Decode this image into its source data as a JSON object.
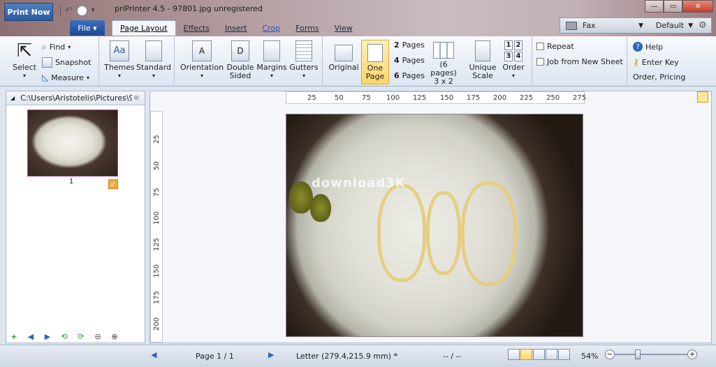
{
  "titlebar": {
    "print_now": "Print Now",
    "title": "priPrinter 4.5 - 97801.jpg unregistered",
    "min": "—",
    "max": "▭",
    "close": "✕"
  },
  "tabs": {
    "file": "File ▾",
    "items": [
      "Page Layout",
      "Effects",
      "Insert",
      "Crop",
      "Forms",
      "View"
    ]
  },
  "printer": {
    "name": "Fax",
    "profile": "Default"
  },
  "ribbon": {
    "select": "Select",
    "find": "Find",
    "snapshot": "Snapshot",
    "measure": "Measure",
    "themes": "Themes",
    "standard": "Standard",
    "orientation": "Orientation",
    "double_sided": "Double Sided",
    "margins": "Margins",
    "gutters": "Gutters",
    "original": "Original",
    "one_page": "One Page",
    "pages2_num": "2",
    "pages4_num": "4",
    "pages6_num": "6",
    "pages_label": "Pages",
    "pages_grid_a": "(6 pages)",
    "pages_grid_b": "3 x 2",
    "unique_scale": "Unique Scale",
    "order": "Order",
    "order_nums": [
      "1",
      "2",
      "3",
      "4"
    ],
    "repeat": "Repeat",
    "job_new_sheet": "Job from New Sheet",
    "help": "Help",
    "enter_key": "Enter Key",
    "order_pricing": "Order, Pricing"
  },
  "left_pane": {
    "path": "C:\\Users\\Aristotelis\\Pictures\\9...",
    "thumb_number": "1"
  },
  "ruler": {
    "h": [
      "25",
      "50",
      "75",
      "100",
      "125",
      "150",
      "175",
      "200",
      "225",
      "250",
      "275"
    ],
    "v": [
      "25",
      "50",
      "75",
      "100",
      "125",
      "150",
      "175",
      "200"
    ]
  },
  "photo": {
    "watermark": "download3K"
  },
  "status": {
    "page": "Page 1 / 1",
    "paper": "Letter (279.4,215.9 mm)",
    "coords": "-- / --",
    "zoom": "54%",
    "zoom_level": 0.3
  }
}
